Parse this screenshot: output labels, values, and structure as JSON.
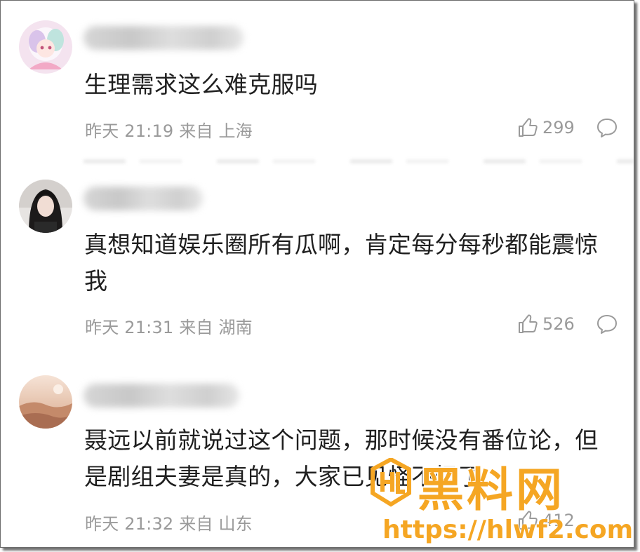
{
  "comments": [
    {
      "content": "生理需求这么难克服吗",
      "time_location": "昨天 21:19 来自 上海",
      "likes": "299"
    },
    {
      "content": "真想知道娱乐圈所有瓜啊，肯定每分每秒都能震惊我",
      "time_location": "昨天 21:31 来自 湖南",
      "likes": "526"
    },
    {
      "content": "聂远以前就说过这个问题，那时候没有番位论，但是剧组夫妻是真的，大家已见怪不怪了",
      "time_location": "昨天 21:32 来自 山东",
      "likes": "412"
    }
  ],
  "icons": {
    "like": "thumbs-up-icon",
    "reply": "speech-bubble-icon"
  },
  "watermark": {
    "title": "黑料网",
    "url": "https://hlwf2.com"
  },
  "colors": {
    "text": "#1f1f1f",
    "meta": "#9a9a9a",
    "watermark": "#f5a623"
  }
}
